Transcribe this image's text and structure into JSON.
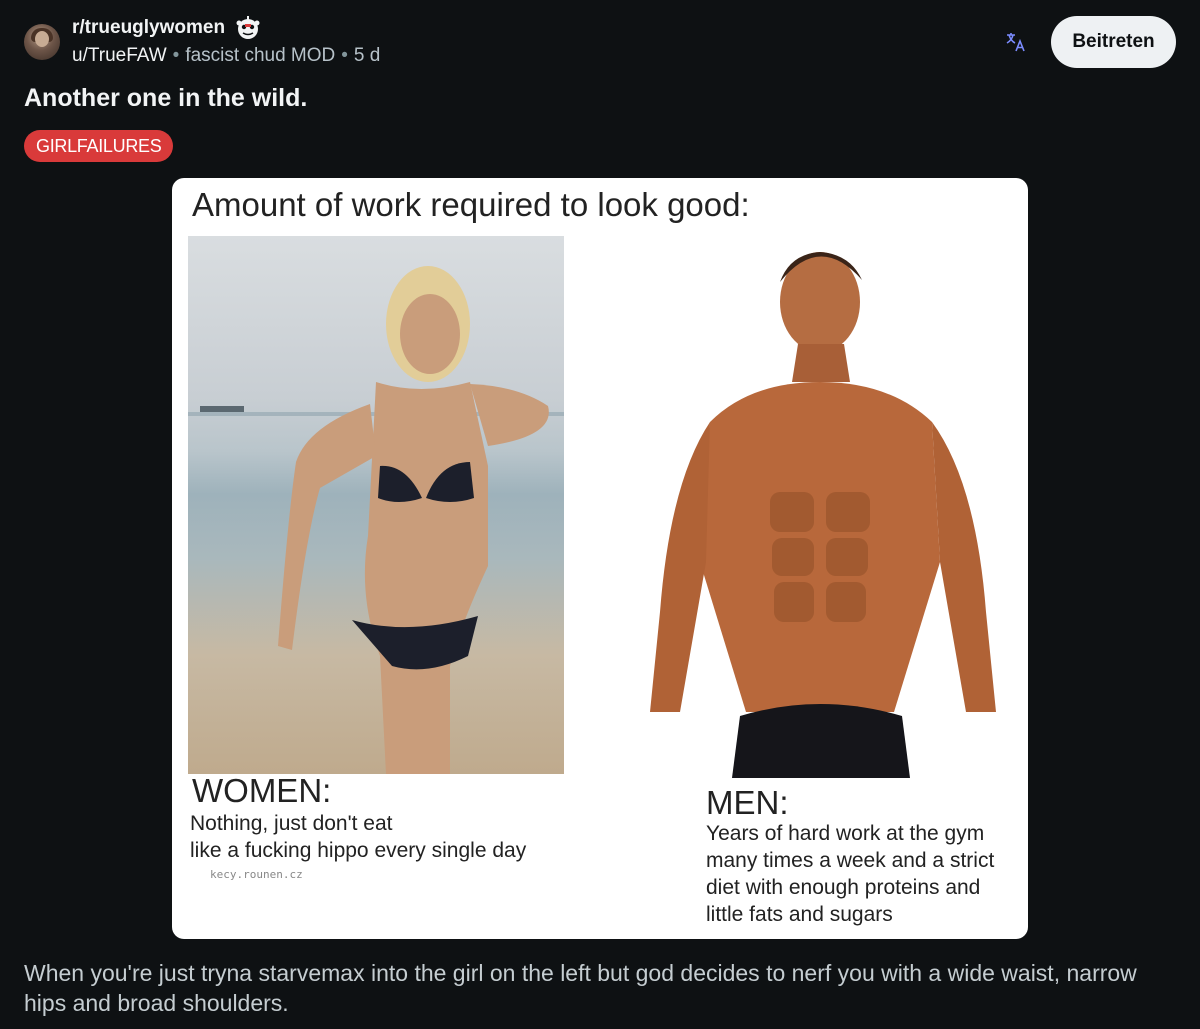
{
  "post": {
    "subreddit": "r/trueuglywomen",
    "author": "u/TrueFAW",
    "author_flair": "fascist chud MOD",
    "age": "5 d",
    "join_label": "Beitreten",
    "title": "Another one in the wild.",
    "flair": "GIRLFAILURES",
    "body": "When you're just tryna starvemax into the girl on the left but god decides to nerf you with a wide waist, narrow hips and broad shoulders."
  },
  "meme": {
    "title": "Amount of work required to look good:",
    "women_heading": "WOMEN:",
    "women_text_1": "Nothing, just don't eat",
    "women_text_2": "like a fucking hippo every single day",
    "watermark": "kecy.rounen.cz",
    "men_heading": "MEN:",
    "men_text_1": "Years of hard work at the gym",
    "men_text_2": "many times a week and a strict",
    "men_text_3": "diet with enough proteins and",
    "men_text_4": "little fats and sugars"
  },
  "colors": {
    "background": "#0e1113",
    "flair_bg": "#d93a3a",
    "join_bg": "#eef1f3",
    "translate_icon": "#7b8cff"
  },
  "icons": {
    "mod": "mod-shield-icon",
    "translate": "translate-icon"
  }
}
